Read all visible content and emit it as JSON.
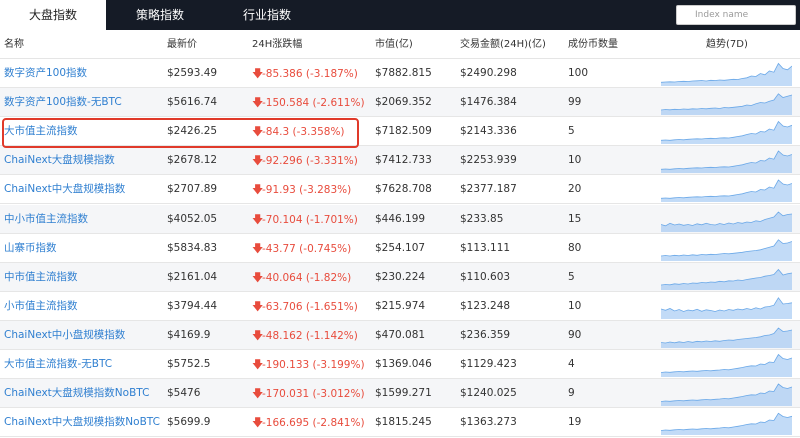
{
  "tabs": [
    {
      "label": "大盘指数"
    },
    {
      "label": "策略指数"
    },
    {
      "label": "行业指数"
    }
  ],
  "search": {
    "placeholder": "Index name"
  },
  "columns": {
    "name": "名称",
    "price": "最新价",
    "change": "24H涨跌幅",
    "market_cap": "市值(亿)",
    "volume": "交易金额(24H)(亿)",
    "count": "成份币数量",
    "trend": "趋势(7D)"
  },
  "colors": {
    "accent": "#2f7fd0",
    "down": "#e84c3d",
    "topbar": "#151b26",
    "sparkline": "#8fbef0"
  },
  "rows": [
    {
      "name": "数字资产100指数",
      "price": "$2593.49",
      "change": "-85.386 (-3.187%)",
      "market_cap": "$7882.815",
      "volume": "$2490.298",
      "count": "100",
      "trend": [
        0.15,
        0.16,
        0.17,
        0.16,
        0.18,
        0.19,
        0.18,
        0.2,
        0.21,
        0.22,
        0.2,
        0.23,
        0.22,
        0.24,
        0.23,
        0.25,
        0.27,
        0.26,
        0.3,
        0.33,
        0.4,
        0.38,
        0.5,
        0.45,
        0.6,
        0.55,
        0.9,
        0.7,
        0.65,
        0.8
      ]
    },
    {
      "name": "数字资产100指数-无BTC",
      "price": "$5616.74",
      "change": "-150.584 (-2.611%)",
      "market_cap": "$2069.352",
      "volume": "$1476.384",
      "count": "99",
      "trend": [
        0.2,
        0.22,
        0.21,
        0.23,
        0.22,
        0.24,
        0.23,
        0.25,
        0.24,
        0.26,
        0.25,
        0.27,
        0.28,
        0.26,
        0.3,
        0.29,
        0.31,
        0.33,
        0.35,
        0.4,
        0.38,
        0.45,
        0.5,
        0.48,
        0.55,
        0.6,
        0.85,
        0.7,
        0.75,
        0.8
      ]
    },
    {
      "name": "大市值主流指数",
      "price": "$2426.25",
      "change": "-84.3 (-3.358%)",
      "market_cap": "$7182.509",
      "volume": "$2143.336",
      "count": "5",
      "trend": [
        0.15,
        0.16,
        0.15,
        0.17,
        0.18,
        0.17,
        0.19,
        0.2,
        0.21,
        0.2,
        0.22,
        0.23,
        0.22,
        0.24,
        0.25,
        0.24,
        0.27,
        0.3,
        0.33,
        0.38,
        0.42,
        0.4,
        0.5,
        0.48,
        0.6,
        0.55,
        0.9,
        0.72,
        0.68,
        0.75
      ]
    },
    {
      "name": "ChaiNext大盘规模指数",
      "price": "$2678.12",
      "change": "-92.296 (-3.331%)",
      "market_cap": "$7412.733",
      "volume": "$2253.939",
      "count": "10",
      "trend": [
        0.15,
        0.16,
        0.15,
        0.17,
        0.18,
        0.17,
        0.19,
        0.2,
        0.21,
        0.2,
        0.22,
        0.23,
        0.22,
        0.24,
        0.25,
        0.24,
        0.27,
        0.3,
        0.33,
        0.38,
        0.42,
        0.4,
        0.5,
        0.48,
        0.6,
        0.55,
        0.88,
        0.72,
        0.68,
        0.74
      ]
    },
    {
      "name": "ChaiNext中大盘规模指数",
      "price": "$2707.89",
      "change": "-91.93 (-3.283%)",
      "market_cap": "$7628.708",
      "volume": "$2377.187",
      "count": "20",
      "trend": [
        0.15,
        0.16,
        0.15,
        0.17,
        0.18,
        0.17,
        0.19,
        0.2,
        0.21,
        0.2,
        0.22,
        0.23,
        0.22,
        0.24,
        0.25,
        0.24,
        0.27,
        0.3,
        0.33,
        0.38,
        0.42,
        0.4,
        0.5,
        0.48,
        0.6,
        0.55,
        0.88,
        0.72,
        0.68,
        0.74
      ]
    },
    {
      "name": "中小市值主流指数",
      "price": "$4052.05",
      "change": "-70.104 (-1.701%)",
      "market_cap": "$446.199",
      "volume": "$233.85",
      "count": "15",
      "trend": [
        0.3,
        0.25,
        0.35,
        0.28,
        0.32,
        0.27,
        0.3,
        0.26,
        0.33,
        0.29,
        0.35,
        0.3,
        0.28,
        0.34,
        0.3,
        0.36,
        0.32,
        0.38,
        0.35,
        0.4,
        0.38,
        0.45,
        0.42,
        0.5,
        0.55,
        0.6,
        0.8,
        0.65,
        0.7,
        0.72
      ]
    },
    {
      "name": "山寨币指数",
      "price": "$5834.83",
      "change": "-43.77 (-0.745%)",
      "market_cap": "$254.107",
      "volume": "$113.111",
      "count": "80",
      "trend": [
        0.2,
        0.22,
        0.2,
        0.23,
        0.21,
        0.24,
        0.22,
        0.25,
        0.23,
        0.26,
        0.25,
        0.27,
        0.26,
        0.28,
        0.3,
        0.29,
        0.31,
        0.33,
        0.35,
        0.38,
        0.4,
        0.42,
        0.45,
        0.5,
        0.55,
        0.6,
        0.85,
        0.7,
        0.72,
        0.78
      ]
    },
    {
      "name": "中市值主流指数",
      "price": "$2161.04",
      "change": "-40.064 (-1.82%)",
      "market_cap": "$230.224",
      "volume": "$110.603",
      "count": "5",
      "trend": [
        0.2,
        0.22,
        0.21,
        0.25,
        0.23,
        0.26,
        0.24,
        0.28,
        0.27,
        0.3,
        0.29,
        0.32,
        0.31,
        0.35,
        0.33,
        0.37,
        0.36,
        0.4,
        0.38,
        0.42,
        0.45,
        0.48,
        0.5,
        0.55,
        0.58,
        0.62,
        0.82,
        0.6,
        0.65,
        0.68
      ]
    },
    {
      "name": "小市值主流指数",
      "price": "$3794.44",
      "change": "-63.706 (-1.651%)",
      "market_cap": "$215.974",
      "volume": "$123.248",
      "count": "10",
      "trend": [
        0.4,
        0.35,
        0.42,
        0.32,
        0.38,
        0.3,
        0.36,
        0.33,
        0.39,
        0.31,
        0.37,
        0.34,
        0.3,
        0.36,
        0.32,
        0.38,
        0.35,
        0.4,
        0.37,
        0.42,
        0.38,
        0.45,
        0.4,
        0.48,
        0.5,
        0.55,
        0.85,
        0.6,
        0.62,
        0.65
      ]
    },
    {
      "name": "ChaiNext中小盘规模指数",
      "price": "$4169.9",
      "change": "-48.162 (-1.142%)",
      "market_cap": "$470.081",
      "volume": "$236.359",
      "count": "90",
      "trend": [
        0.22,
        0.2,
        0.24,
        0.21,
        0.25,
        0.22,
        0.26,
        0.23,
        0.27,
        0.25,
        0.28,
        0.26,
        0.29,
        0.27,
        0.3,
        0.32,
        0.31,
        0.34,
        0.36,
        0.38,
        0.4,
        0.42,
        0.45,
        0.5,
        0.52,
        0.58,
        0.8,
        0.66,
        0.68,
        0.72
      ]
    },
    {
      "name": "大市值主流指数-无BTC",
      "price": "$5752.5",
      "change": "-190.133 (-3.199%)",
      "market_cap": "$1369.046",
      "volume": "$1129.423",
      "count": "4",
      "trend": [
        0.18,
        0.2,
        0.19,
        0.21,
        0.22,
        0.21,
        0.23,
        0.24,
        0.23,
        0.25,
        0.26,
        0.25,
        0.27,
        0.28,
        0.3,
        0.29,
        0.32,
        0.35,
        0.38,
        0.42,
        0.45,
        0.44,
        0.52,
        0.5,
        0.6,
        0.58,
        0.9,
        0.74,
        0.7,
        0.76
      ]
    },
    {
      "name": "ChaiNext大盘规模指数NoBTC",
      "price": "$5476",
      "change": "-170.031 (-3.012%)",
      "market_cap": "$1599.271",
      "volume": "$1240.025",
      "count": "9",
      "trend": [
        0.18,
        0.2,
        0.19,
        0.21,
        0.22,
        0.21,
        0.23,
        0.24,
        0.23,
        0.25,
        0.26,
        0.25,
        0.27,
        0.28,
        0.3,
        0.29,
        0.32,
        0.35,
        0.38,
        0.42,
        0.45,
        0.44,
        0.52,
        0.5,
        0.6,
        0.58,
        0.88,
        0.74,
        0.7,
        0.76
      ]
    },
    {
      "name": "ChaiNext中大盘规模指数NoBTC",
      "price": "$5699.9",
      "change": "-166.695 (-2.841%)",
      "market_cap": "$1815.245",
      "volume": "$1363.273",
      "count": "19",
      "trend": [
        0.18,
        0.2,
        0.19,
        0.21,
        0.22,
        0.21,
        0.23,
        0.24,
        0.23,
        0.25,
        0.26,
        0.25,
        0.27,
        0.28,
        0.3,
        0.29,
        0.32,
        0.35,
        0.38,
        0.42,
        0.45,
        0.44,
        0.52,
        0.5,
        0.6,
        0.58,
        0.87,
        0.74,
        0.7,
        0.75
      ]
    }
  ]
}
